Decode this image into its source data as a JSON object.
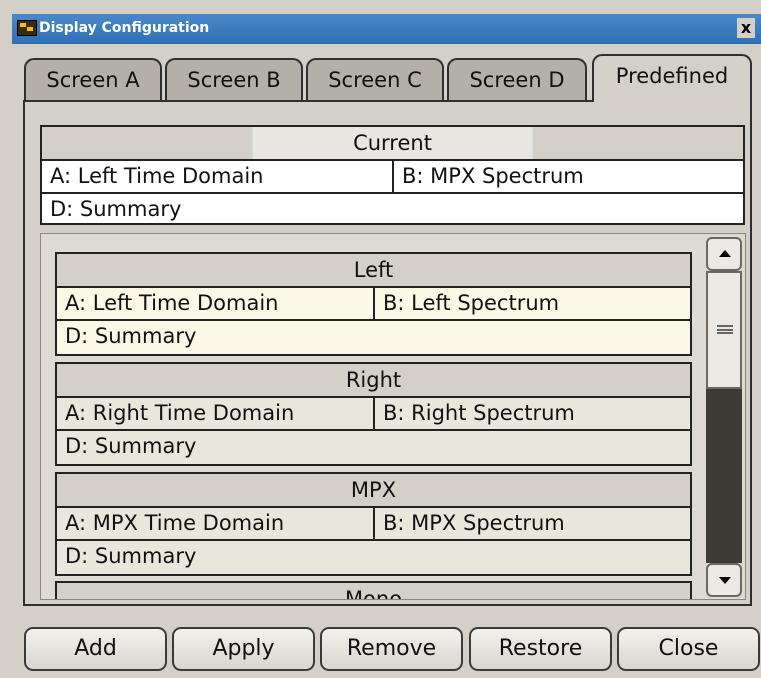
{
  "window": {
    "title": "Display Configuration",
    "close_label": "x"
  },
  "tabs": [
    "Screen A",
    "Screen B",
    "Screen C",
    "Screen D",
    "Predefined"
  ],
  "active_tab": "Predefined",
  "current": {
    "header": "Current",
    "a": "A: Left Time Domain",
    "b": "B: MPX Spectrum",
    "d": "D: Summary"
  },
  "configs": [
    {
      "name": "Left",
      "a": "A: Left Time Domain",
      "b": "B: Left Spectrum",
      "d": "D: Summary"
    },
    {
      "name": "Right",
      "a": "A: Right Time Domain",
      "b": "B: Right Spectrum",
      "d": "D: Summary"
    },
    {
      "name": "MPX",
      "a": "A: MPX Time Domain",
      "b": "B: MPX Spectrum",
      "d": "D: Summary"
    },
    {
      "name": "Mono"
    }
  ],
  "buttons": {
    "add": "Add",
    "apply": "Apply",
    "remove": "Remove",
    "restore": "Restore",
    "close": "Close"
  },
  "icons": {
    "window_icon": "display-config-icon",
    "scroll_up": "arrow-up-icon",
    "scroll_down": "arrow-down-icon",
    "scroll_grip": "grip-icon"
  }
}
